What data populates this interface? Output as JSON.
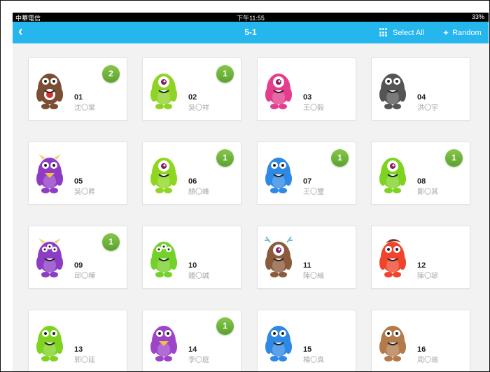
{
  "status_bar": {
    "carrier": "中華電信",
    "time": "下午11:55",
    "battery": "33%"
  },
  "nav": {
    "back_icon": "chevron-left-icon",
    "title": "5-1",
    "select_all": "Select All",
    "random": "Random"
  },
  "students": [
    {
      "number": "01",
      "name": "沈〇棠",
      "badge": "2",
      "color": "#7b4d32",
      "monster": "brown-fuzzy-red-belly"
    },
    {
      "number": "02",
      "name": "吳〇祥",
      "badge": "1",
      "color": "#8fd327",
      "monster": "green-one-eye"
    },
    {
      "number": "03",
      "name": "王〇毅",
      "badge": "",
      "color": "#e43d8d",
      "monster": "pink-one-eye"
    },
    {
      "number": "04",
      "name": "洪〇宇",
      "badge": "",
      "color": "#555555",
      "monster": "gray-ears"
    },
    {
      "number": "05",
      "name": "吳〇昇",
      "badge": "",
      "color": "#8f3cc4",
      "monster": "purple-horned-beak"
    },
    {
      "number": "06",
      "name": "顏〇峰",
      "badge": "1",
      "color": "#8ed61f",
      "monster": "green-one-eye-round"
    },
    {
      "number": "07",
      "name": "王〇璽",
      "badge": "1",
      "color": "#2e88e6",
      "monster": "blue-fuzzy"
    },
    {
      "number": "08",
      "name": "鄭〇其",
      "badge": "1",
      "color": "#7ed321",
      "monster": "green-red-eye"
    },
    {
      "number": "09",
      "name": "邱〇樺",
      "badge": "1",
      "color": "#8c3dc4",
      "monster": "purple-three-eye"
    },
    {
      "number": "10",
      "name": "鍾〇誠",
      "badge": "",
      "color": "#74d12b",
      "monster": "green-three-eye"
    },
    {
      "number": "11",
      "name": "陳〇綸",
      "badge": "",
      "color": "#8b5a3c",
      "monster": "brown-antlers"
    },
    {
      "number": "12",
      "name": "陳〇諺",
      "badge": "",
      "color": "#f0452c",
      "monster": "red-hair"
    },
    {
      "number": "13",
      "name": "郭〇廷",
      "badge": "",
      "color": "#7ed321",
      "monster": "green-antenna"
    },
    {
      "number": "14",
      "name": "李〇庭",
      "badge": "1",
      "color": "#9c45c8",
      "monster": "purple-beak"
    },
    {
      "number": "15",
      "name": "楊〇真",
      "badge": "",
      "color": "#2e88e6",
      "monster": "blue-fuzzy"
    },
    {
      "number": "16",
      "name": "周〇瑜",
      "badge": "",
      "color": "#b37a4b",
      "monster": "tan-dog"
    }
  ]
}
